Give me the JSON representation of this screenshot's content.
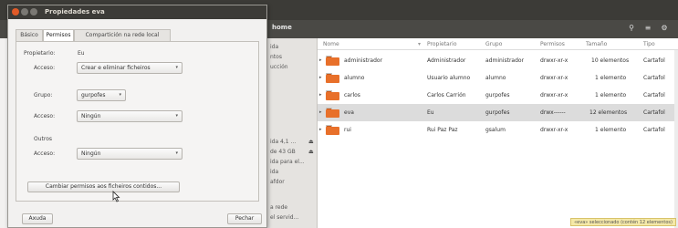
{
  "file_manager": {
    "location": "home",
    "tool_icons": [
      "search-icon",
      "list-view-icon",
      "settings-icon"
    ],
    "columns": [
      "Nome",
      "Propietario",
      "Grupo",
      "Permisos",
      "Tamaño",
      "Tipo"
    ],
    "rows": [
      {
        "name": "administrador",
        "owner": "Administrador",
        "group": "administrador",
        "perms": "drwxr-xr-x",
        "size": "10 elementos",
        "type": "Cartafol"
      },
      {
        "name": "alumno",
        "owner": "Usuario alumno",
        "group": "alumno",
        "perms": "drwxr-xr-x",
        "size": "1 elemento",
        "type": "Cartafol"
      },
      {
        "name": "carlos",
        "owner": "Carlos Carrión",
        "group": "gurpofes",
        "perms": "drwxr-xr-x",
        "size": "1 elemento",
        "type": "Cartafol"
      },
      {
        "name": "eva",
        "owner": "Eu",
        "group": "gurpofes",
        "perms": "drwx------",
        "size": "12 elementos",
        "type": "Cartafol"
      },
      {
        "name": "rui",
        "owner": "Rui Paz Paz",
        "group": "gsalum",
        "perms": "drwxr-xr-x",
        "size": "1 elemento",
        "type": "Cartafol"
      }
    ],
    "sidebar": [
      "ida",
      "ntos",
      "ucción",
      "ga",
      "e",
      "",
      "",
      "",
      "",
      "",
      "",
      "",
      "",
      "",
      "ida 4,1 ...",
      "de 43 GB",
      "ida para el...",
      "ida",
      "afdor",
      "",
      "a rede",
      "el servid..."
    ],
    "status": "«eva» seleccionado (contén 12 elementos)"
  },
  "dialog": {
    "title": "Propiedades eva",
    "tabs": [
      "Básico",
      "Permisos",
      "Compartición na rede local"
    ],
    "active_tab": 1,
    "owner_label": "Propietario:",
    "owner_value": "Eu",
    "owner_access_label": "Acceso:",
    "owner_access_value": "Crear e eliminar ficheiros",
    "group_label": "Grupo:",
    "group_value": "gurpofes",
    "group_access_label": "Acceso:",
    "group_access_value": "Ningún",
    "others_label": "Outros",
    "others_access_label": "Acceso:",
    "others_access_value": "Ningún",
    "change_button": "Cambiar permisos aos ficheiros contidos...",
    "help_button": "Axuda",
    "close_button": "Pechar"
  }
}
